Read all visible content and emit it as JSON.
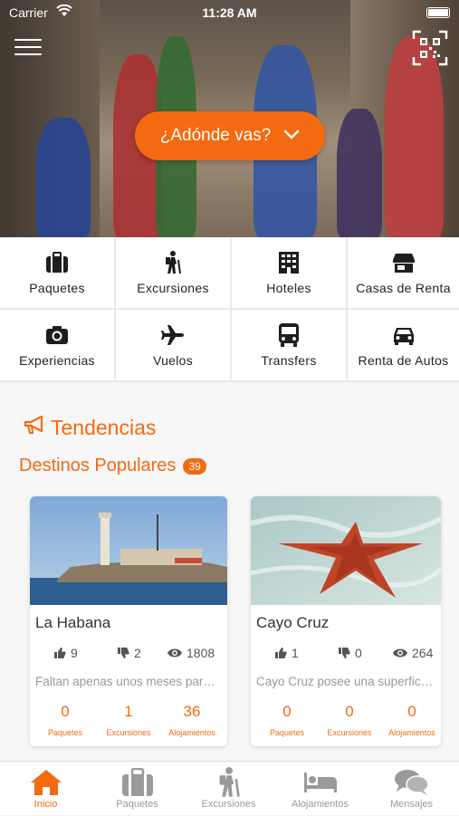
{
  "status_bar": {
    "carrier": "Carrier",
    "time": "11:28 AM"
  },
  "hero": {
    "destination_button": "¿Adónde vas?"
  },
  "categories": [
    {
      "label": "Paquetes",
      "icon": "suitcase-icon"
    },
    {
      "label": "Excursiones",
      "icon": "hiker-icon"
    },
    {
      "label": "Hoteles",
      "icon": "building-icon"
    },
    {
      "label": "Casas de Renta",
      "icon": "store-icon"
    },
    {
      "label": "Experiencias",
      "icon": "camera-icon"
    },
    {
      "label": "Vuelos",
      "icon": "plane-icon"
    },
    {
      "label": "Transfers",
      "icon": "bus-icon"
    },
    {
      "label": "Renta de Autos",
      "icon": "car-icon"
    }
  ],
  "trends": {
    "title": "Tendencias",
    "section": "Destinos Populares",
    "count": "39"
  },
  "destinations": [
    {
      "name": "La Habana",
      "likes": "9",
      "dislikes": "2",
      "views": "1808",
      "description": "Faltan apenas unos meses para…",
      "paquetes": "0",
      "excursiones": "1",
      "alojamientos": "36"
    },
    {
      "name": "Cayo Cruz",
      "likes": "1",
      "dislikes": "0",
      "views": "264",
      "description": "Cayo Cruz posee una superfici…",
      "paquetes": "0",
      "excursiones": "0",
      "alojamientos": "0"
    }
  ],
  "count_labels": {
    "paquetes": "Paquetes",
    "excursiones": "Excursiones",
    "alojamientos": "Alojamientos"
  },
  "tabs": [
    {
      "label": "Inicio",
      "icon": "home-icon",
      "active": true
    },
    {
      "label": "Paquetes",
      "icon": "suitcase-icon",
      "active": false
    },
    {
      "label": "Excursiones",
      "icon": "hiker-icon",
      "active": false
    },
    {
      "label": "Alojamientos",
      "icon": "bed-icon",
      "active": false
    },
    {
      "label": "Mensajes",
      "icon": "chat-icon",
      "active": false
    }
  ],
  "colors": {
    "accent": "#f36a10",
    "icon_dark": "#1e1e1e",
    "tab_inactive": "#9a9a9a"
  }
}
